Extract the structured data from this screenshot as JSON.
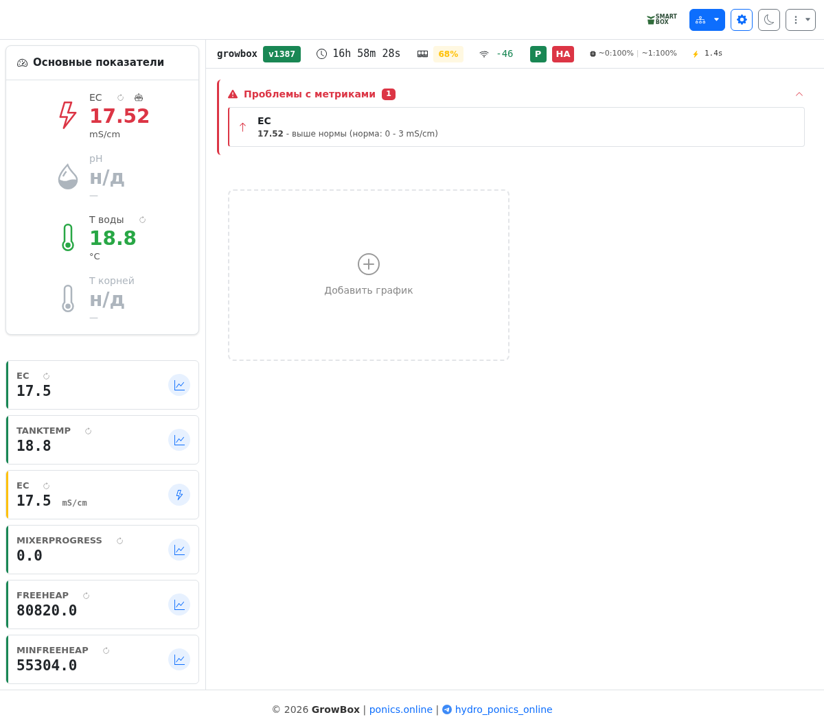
{
  "header": {
    "logo": [
      "SMART",
      "BOX"
    ],
    "toolbar": [
      {
        "kind": "network",
        "dropdown": true
      },
      {
        "kind": "settings",
        "dropdown": false
      },
      {
        "kind": "theme",
        "dropdown": false
      },
      {
        "kind": "more",
        "dropdown": true
      }
    ]
  },
  "status_bar": {
    "device": "growbox",
    "version": "v1387",
    "uptime": "16h 58m 28s",
    "memory": "68%",
    "wifi": "-46",
    "badges": [
      {
        "text": "P",
        "color": "#198754"
      },
      {
        "text": "HA",
        "color": "#dc3545"
      }
    ],
    "cpu_cores": [
      "~0:100%",
      "~1:100%"
    ],
    "separator": "|",
    "response_time": "1.4s"
  },
  "main_metrics": {
    "title": "Основные показатели",
    "items": [
      {
        "kind": "bolt",
        "label": "EC",
        "value": "17.52",
        "unit": "mS/cm",
        "available": true,
        "alert": true,
        "refresh": true,
        "robot": true
      },
      {
        "kind": "drop",
        "label": "pH",
        "value": "н/д",
        "unit": "—",
        "available": false,
        "alert": false,
        "refresh": false,
        "robot": false
      },
      {
        "kind": "thermometer",
        "label": "T воды",
        "value": "18.8",
        "unit": "°C",
        "available": true,
        "alert": false,
        "refresh": true,
        "robot": false
      },
      {
        "kind": "thermometer",
        "label": "T корней",
        "value": "н/д",
        "unit": "—",
        "available": false,
        "alert": false,
        "refresh": false,
        "robot": false
      }
    ]
  },
  "metric_cards": [
    {
      "kind": "chart",
      "label": "EC",
      "value": "17.5",
      "color": "#198754"
    },
    {
      "kind": "chart",
      "label": "TANKTEMP",
      "value": "18.8",
      "color": "#198754"
    },
    {
      "kind": "bolt",
      "label": "EC",
      "value": "17.5",
      "unit": "mS/cm",
      "color": "#ffc107"
    },
    {
      "kind": "chart",
      "label": "MIXERPROGRESS",
      "value": "0.0",
      "color": "#198754"
    },
    {
      "kind": "chart",
      "label": "FREEHEAP",
      "value": "80820.0",
      "color": "#198754"
    },
    {
      "kind": "chart",
      "label": "MINFREEHEAP",
      "value": "55304.0",
      "color": "#198754"
    }
  ],
  "problems": {
    "title": "Проблемы с метриками",
    "count": "1",
    "expanded": true,
    "items": [
      {
        "kind": "up",
        "name": "EC",
        "text": "**17.52** - выше нормы (норма: 0 - 3 mS/cm)"
      }
    ]
  },
  "add_chart": {
    "label": "Добавить график"
  },
  "footer": {
    "copyright": "© 2026 **GrowBox**",
    "separator": "|",
    "links": [
      {
        "kind": "web",
        "text": "ponics.online"
      },
      {
        "kind": "telegram",
        "text": "hydro_ponics_online"
      }
    ]
  }
}
